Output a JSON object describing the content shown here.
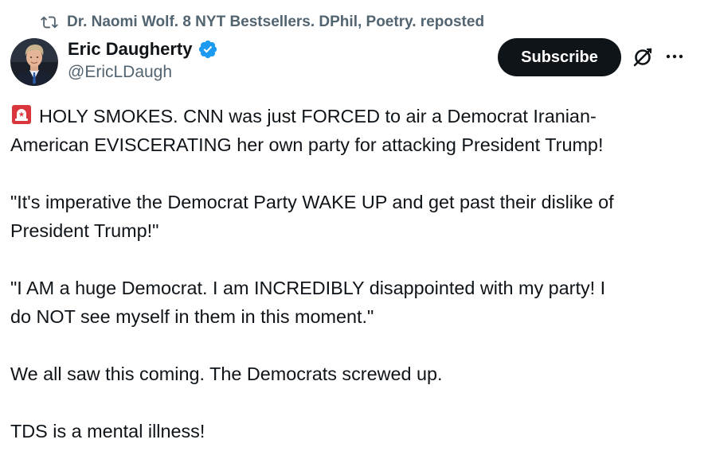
{
  "repost": {
    "icon": "repost-icon",
    "text": "Dr. Naomi Wolf. 8 NYT Bestsellers. DPhil, Poetry. reposted"
  },
  "author": {
    "name": "Eric Daugherty",
    "handle": "@EricLDaugh",
    "verified": true,
    "avatar_icon": "avatar"
  },
  "actions": {
    "subscribe_label": "Subscribe",
    "grok_icon": "grok-icon",
    "more_icon": "more-icon"
  },
  "tweet": {
    "emoji": "siren-icon",
    "line1": "HOLY SMOKES. CNN was just FORCED to air a Democrat Iranian-",
    "line2": "American EVISCERATING her own party for attacking President Trump!",
    "para2_line1": "\"It's imperative the Democrat Party WAKE UP and get past their dislike of",
    "para2_line2": "President Trump!\"",
    "para3_line1": "\"I AM a huge Democrat. I am INCREDIBLY disappointed with my party! I",
    "para3_line2": "do NOT see myself in them in this moment.\"",
    "para4": "We all saw this coming. The Democrats screwed up.",
    "para5": "TDS is a mental illness!"
  },
  "colors": {
    "text": "#0f1419",
    "secondary": "#536471",
    "verified_blue": "#1d9bf0",
    "subscribe_bg": "#0f1419"
  }
}
